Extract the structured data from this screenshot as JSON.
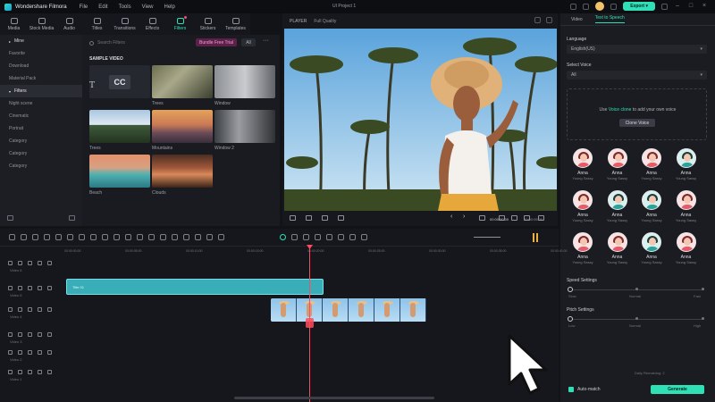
{
  "app": {
    "name": "Wondershare Filmora",
    "menu": [
      "File",
      "Edit",
      "Tools",
      "View",
      "Help"
    ],
    "project_title": "UI Project 1",
    "export_label": "Export",
    "export_chevron": "▾"
  },
  "toolbar": {
    "tools": [
      {
        "label": "Media",
        "icon": "media-icon"
      },
      {
        "label": "Stock Media",
        "icon": "stock-media-icon"
      },
      {
        "label": "Audio",
        "icon": "audio-icon"
      },
      {
        "label": "Titles",
        "icon": "titles-icon"
      },
      {
        "label": "Transitions",
        "icon": "transitions-icon"
      },
      {
        "label": "Effects",
        "icon": "effects-icon"
      },
      {
        "label": "Filters",
        "icon": "filters-icon",
        "active": true
      },
      {
        "label": "Stickers",
        "icon": "stickers-icon"
      },
      {
        "label": "Templates",
        "icon": "templates-icon"
      }
    ]
  },
  "library": {
    "sidebar": {
      "mine": "Mine",
      "items_top": [
        "Favorite",
        "Download",
        "Material Pack"
      ],
      "filters": "Filters",
      "items_filters": [
        "Night scene",
        "Cinematic",
        "Portrait",
        "Category",
        "Category",
        "Category"
      ]
    },
    "search_placeholder": "Search Filters",
    "free_badge": "Bundle Free Trial",
    "all_label": "All",
    "more": "···",
    "sample_title": "SAMPLE VIDEO",
    "cc_text": "CC",
    "thumbs": [
      {
        "label": "",
        "kind": "cc"
      },
      {
        "label": "Trees",
        "kind": "trees"
      },
      {
        "label": "Window",
        "kind": "window"
      },
      {
        "label": "Trees",
        "kind": "cabin"
      },
      {
        "label": "Mountains",
        "kind": "mountains"
      },
      {
        "label": "Window 2",
        "kind": "window2"
      },
      {
        "label": "Beach",
        "kind": "beach"
      },
      {
        "label": "Clouds",
        "kind": "clouds"
      }
    ]
  },
  "player": {
    "label": "PLAYER",
    "quality": "Full Quality",
    "progress_fraction": 0.18,
    "time_current": "00:00:00:00",
    "time_total": "00:00:05:00"
  },
  "right_panel": {
    "tabs": [
      "Video",
      "Text to Speech"
    ],
    "active_tab": 1,
    "language_label": "Language",
    "language_value": "English(US)",
    "voice_label": "Select Voice",
    "voice_value": "All",
    "clone_pre": "Use",
    "clone_link": "Voice clone",
    "clone_post": "to add your own voice",
    "clone_button": "Clone Voice",
    "voices": [
      {
        "name": "Anna",
        "sub": "Young Sassy",
        "tone": "pink"
      },
      {
        "name": "Anna",
        "sub": "Young Sassy",
        "tone": "pink"
      },
      {
        "name": "Anna",
        "sub": "Young Sassy",
        "tone": "pink"
      },
      {
        "name": "Anna",
        "sub": "Young Sassy",
        "tone": "teal"
      },
      {
        "name": "Anna",
        "sub": "Young Sassy",
        "tone": "pink"
      },
      {
        "name": "Anna",
        "sub": "Young Sassy",
        "tone": "teal"
      },
      {
        "name": "Anna",
        "sub": "Young Sassy",
        "tone": "teal"
      },
      {
        "name": "Anna",
        "sub": "Young Sassy",
        "tone": "pink"
      },
      {
        "name": "Anna",
        "sub": "Young Sassy",
        "tone": "pink"
      },
      {
        "name": "Anna",
        "sub": "Young Sassy",
        "tone": "pink"
      },
      {
        "name": "Anna",
        "sub": "Young Sassy",
        "tone": "teal"
      },
      {
        "name": "Anna",
        "sub": "Young Sassy",
        "tone": "pink"
      }
    ],
    "speed_label": "Speed Settings",
    "speed_low": "Slow",
    "speed_mid": "Normal",
    "speed_high": "Fast",
    "pitch_label": "Pitch Settings",
    "pitch_low": "Low",
    "pitch_mid": "Normal",
    "pitch_high": "High",
    "credit_text": "Daily Remaining: 2",
    "auto_match": "Auto-match",
    "generate": "Generate"
  },
  "timeline": {
    "ruler": [
      "00:00:00:00",
      "00:00:05:00",
      "00:00:10:00",
      "00:00:15:00",
      "00:00:20:00",
      "00:00:25:00",
      "00:00:30:00",
      "00:00:35:00",
      "00:00:40:00"
    ],
    "tracks": [
      "Video 6",
      "Video 5",
      "Video 4",
      "Video 3",
      "Video 2",
      "Video 1"
    ],
    "title_clip_label": "Title 01"
  },
  "colors": {
    "accent": "#2fe0b6",
    "playhead": "#ff4b5c",
    "title_clip": "#3aaeb8",
    "panel": "#1b1c21"
  }
}
